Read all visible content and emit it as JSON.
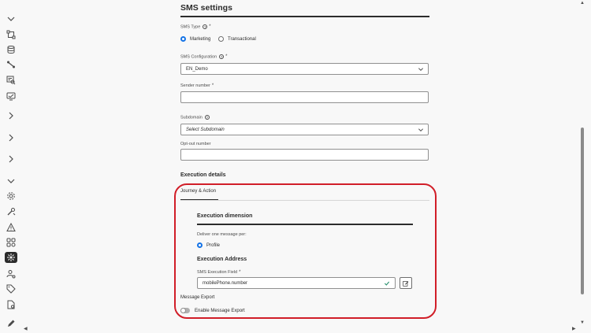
{
  "rail": {
    "icons": [
      "chevron-down-icon",
      "journey-icon",
      "database-icon",
      "connection-icon",
      "audience-search-icon",
      "monitor-icon",
      "chevron-right-icon",
      "chevron-right-icon",
      "chevron-right-icon",
      "chevron-down-icon",
      "settings-gear-icon",
      "tools-icon",
      "alert-icon",
      "workflow-icon",
      "campaign-active-icon",
      "user-settings-icon",
      "tag-icon",
      "document-settings-icon",
      "edit-pencil-icon"
    ]
  },
  "sms_settings": {
    "title": "SMS settings",
    "sms_type_label": "SMS Type",
    "sms_type_options": [
      "Marketing",
      "Transactional"
    ],
    "sms_type_selected": "Marketing",
    "config_label": "SMS Configuration",
    "config_value": "EN_Demo",
    "sender_label": "Sender number",
    "sender_value": "",
    "subdomain_label": "Subdomain",
    "subdomain_placeholder": "Select Subdomain",
    "optout_label": "Opt-out number",
    "optout_value": ""
  },
  "execution": {
    "title": "Execution details",
    "tab_label": "Journey & Action",
    "dimension_title": "Execution dimension",
    "deliver_label": "Deliver one message per:",
    "deliver_option": "Profile",
    "address_title": "Execution Address",
    "field_label": "SMS Execution Field",
    "field_value": "mobilePhone.number",
    "export_label": "Message Export",
    "export_toggle_label": "Enable Message Export",
    "export_enabled": false
  },
  "colors": {
    "accent": "#1473e6",
    "highlight": "#d11e28",
    "success": "#268e6c"
  }
}
